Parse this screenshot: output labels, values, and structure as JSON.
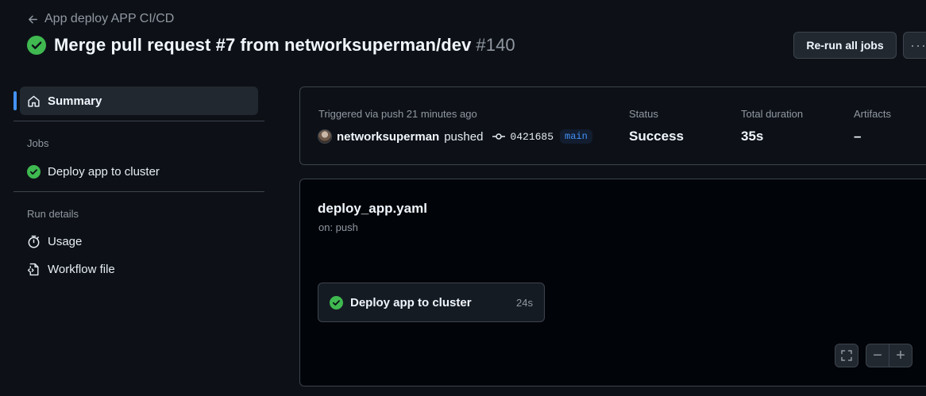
{
  "header": {
    "back_label": "App deploy APP CI/CD",
    "title": "Merge pull request #7 from networksuperman/dev",
    "run_number": "#140",
    "rerun_label": "Re-run all jobs",
    "more_label": "···"
  },
  "sidebar": {
    "summary_label": "Summary",
    "jobs_heading": "Jobs",
    "jobs": [
      {
        "label": "Deploy app to cluster",
        "status": "success"
      }
    ],
    "run_details_heading": "Run details",
    "details": [
      {
        "label": "Usage",
        "icon": "stopwatch-icon"
      },
      {
        "label": "Workflow file",
        "icon": "file-code-icon"
      }
    ]
  },
  "summary": {
    "triggered": "Triggered via push 21 minutes ago",
    "user": "networksuperman",
    "action": "pushed",
    "commit": "0421685",
    "branch": "main",
    "status_label": "Status",
    "status_value": "Success",
    "duration_label": "Total duration",
    "duration_value": "35s",
    "artifacts_label": "Artifacts",
    "artifacts_value": "–"
  },
  "graph": {
    "workflow_file": "deploy_app.yaml",
    "trigger": "on: push",
    "job": {
      "label": "Deploy app to cluster",
      "duration": "24s"
    },
    "zoom_out": "−",
    "zoom_in": "+"
  },
  "colors": {
    "success": "#3fb950",
    "accent": "#4493f8",
    "background": "#0d1117"
  }
}
